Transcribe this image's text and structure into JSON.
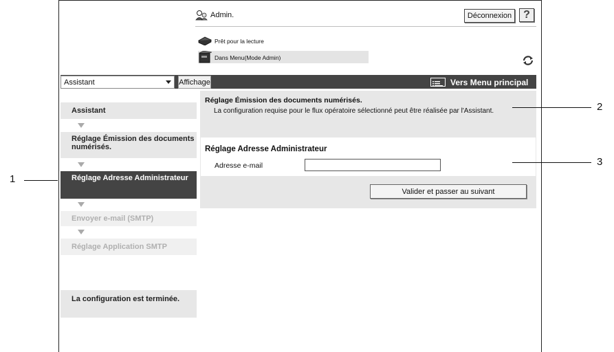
{
  "header": {
    "admin_label": "Admin.",
    "logout_label": "Déconnexion",
    "help_label": "?",
    "status_ready": "Prêt pour la lecture",
    "status_mode": "Dans Menu(Mode Admin)"
  },
  "toolbar": {
    "select_value": "Assistant",
    "display_label": "Affichage",
    "main_menu_label": "Vers Menu principal"
  },
  "steps": [
    {
      "label": "Assistant",
      "state": "normal"
    },
    {
      "label": "Réglage Émission des documents numérisés.",
      "state": "normal"
    },
    {
      "label": "Réglage Adresse Administrateur",
      "state": "active"
    },
    {
      "label": "Envoyer e-mail (SMTP)",
      "state": "disabled"
    },
    {
      "label": "Réglage Application SMTP",
      "state": "disabled"
    },
    {
      "label": "La configuration est terminée.",
      "state": "normal"
    }
  ],
  "main": {
    "title": "Réglage Émission des documents numérisés.",
    "description": "La configuration requise pour le flux opératoire sélectionné peut être réalisée par l'Assistant.",
    "section_title": "Réglage Adresse Administrateur",
    "email_label": "Adresse e-mail",
    "email_value": "",
    "next_button": "Valider et passer au suivant"
  },
  "callouts": [
    "1",
    "2",
    "3"
  ],
  "colors": {
    "dark_bar": "#444444",
    "light_panel": "#e7e7e7",
    "disabled_text": "#b0b0b0"
  }
}
